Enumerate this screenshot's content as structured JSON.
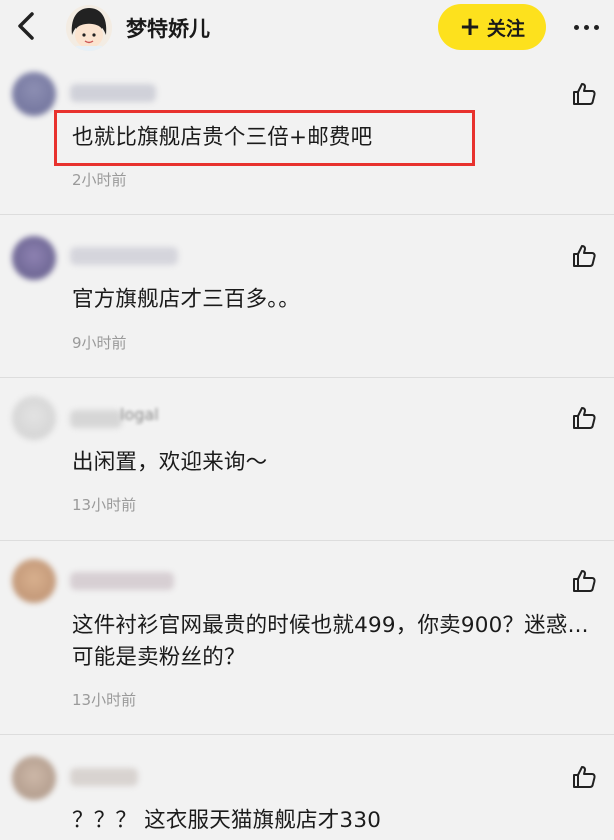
{
  "header": {
    "user_name": "梦特娇儿",
    "follow_label": "关注",
    "follow_plus": "+"
  },
  "comments": [
    {
      "text": "也就比旗舰店贵个三倍+邮费吧",
      "time": "2小时前"
    },
    {
      "text": "官方旗舰店才三百多。。",
      "time": "9小时前"
    },
    {
      "text": "出闲置，欢迎来询～",
      "time": "13小时前",
      "name_fragment": "logal"
    },
    {
      "text": "这件衬衫官网最贵的时候也就499，你卖900？迷惑...可能是卖粉丝的？",
      "time": "13小时前"
    },
    {
      "text": "？？？ 这衣服天猫旗舰店才330",
      "time": ""
    }
  ],
  "colors": {
    "follow_bg": "#fde11d",
    "highlight_border": "#e8322e",
    "background": "#f2f2f2"
  },
  "icons": [
    "back-arrow-icon",
    "avatar-image",
    "more-dots-icon",
    "thumbs-up-icon"
  ]
}
